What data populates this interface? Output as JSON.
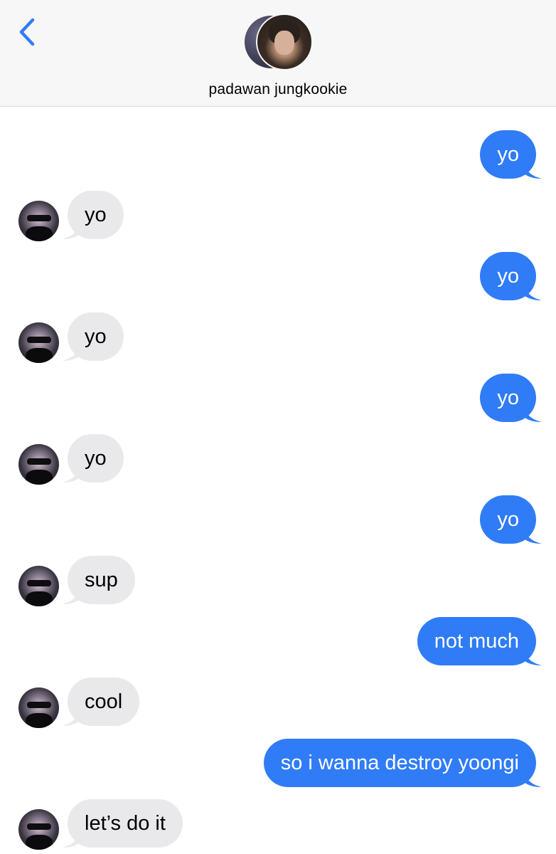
{
  "header": {
    "back_icon": "chevron-left-icon",
    "contact_name": "padawan jungkookie",
    "accent_color": "#2f7cf6"
  },
  "messages": [
    {
      "sender": "me",
      "text": "yo"
    },
    {
      "sender": "them",
      "text": "yo"
    },
    {
      "sender": "me",
      "text": "yo"
    },
    {
      "sender": "them",
      "text": "yo"
    },
    {
      "sender": "me",
      "text": "yo"
    },
    {
      "sender": "them",
      "text": "yo"
    },
    {
      "sender": "me",
      "text": "yo"
    },
    {
      "sender": "them",
      "text": "sup"
    },
    {
      "sender": "me",
      "text": "not much"
    },
    {
      "sender": "them",
      "text": "cool"
    },
    {
      "sender": "me",
      "text": "so i wanna destroy yoongi"
    },
    {
      "sender": "them",
      "text": "let’s do it"
    }
  ],
  "colors": {
    "sent_bubble": "#2f7cf6",
    "received_bubble": "#e9e9eb",
    "header_bg": "#f7f7f7"
  }
}
